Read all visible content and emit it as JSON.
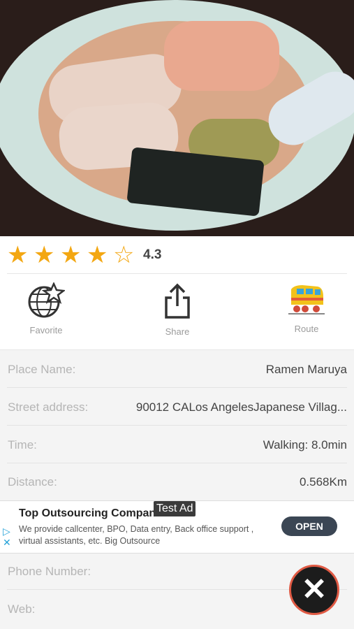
{
  "rating": {
    "value": "4.3",
    "stars_filled": 4,
    "stars_total": 5
  },
  "actions": [
    {
      "label": "Favorite",
      "icon": "globe-star-icon"
    },
    {
      "label": "Share",
      "icon": "share-icon"
    },
    {
      "label": "Route",
      "icon": "train-icon"
    }
  ],
  "info": [
    {
      "label": "Place Name:",
      "value": "Ramen Maruya"
    },
    {
      "label": "Street address:",
      "value": "90012 CALos AngelesJapanese Villag..."
    },
    {
      "label": "Time:",
      "value": "Walking: 8.0min"
    },
    {
      "label": "Distance:",
      "value": "0.568Km"
    },
    {
      "label": "Phone Number:",
      "value": ""
    },
    {
      "label": "Web:",
      "value": ""
    }
  ],
  "ad": {
    "title": "Top Outsourcing Compan",
    "badge": "Test Ad",
    "description": "We provide callcenter, BPO, Data entry, Back office support , virtual assistants, etc. Big Outsource",
    "cta": "OPEN"
  },
  "colors": {
    "star": "#f3a712",
    "close_ring": "#e05a44",
    "close_bg": "#1c1c1c",
    "cta_bg": "#3b4654"
  }
}
